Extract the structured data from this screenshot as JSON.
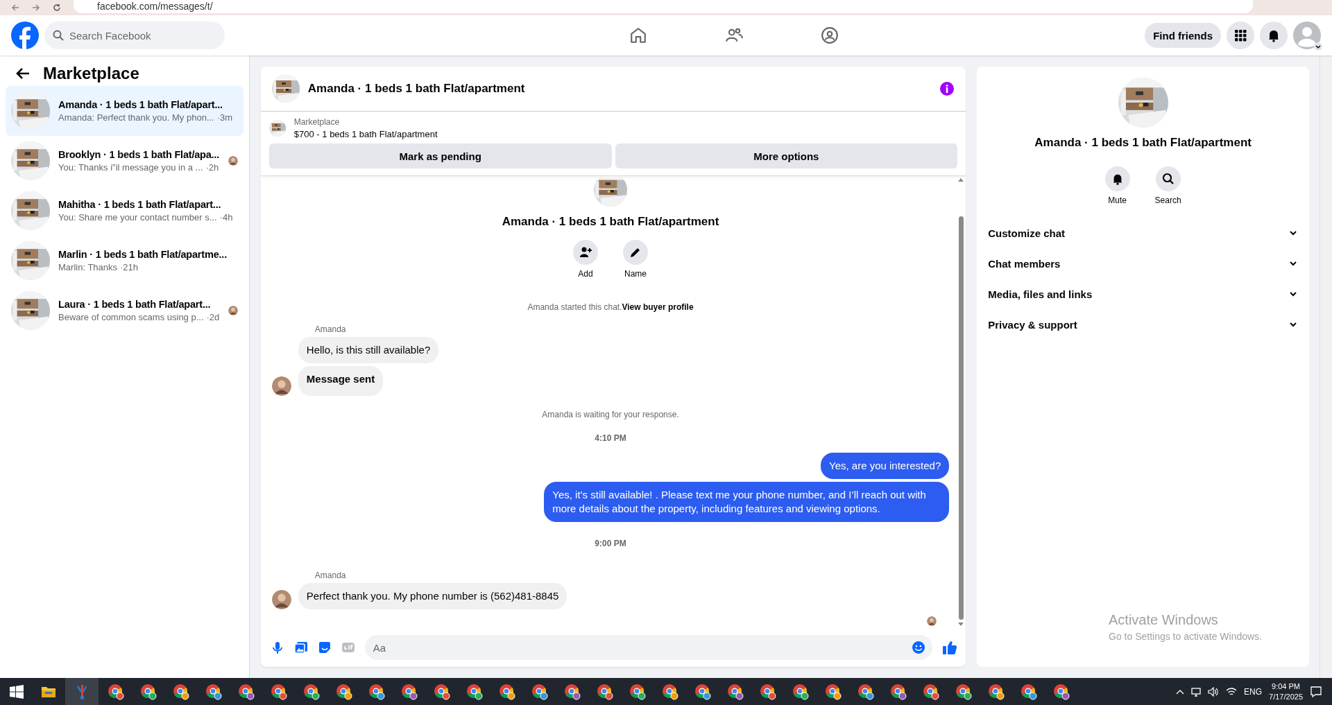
{
  "browser": {
    "address": "facebook.com/messages/t/"
  },
  "header": {
    "search_placeholder": "Search Facebook",
    "find_friends": "Find friends"
  },
  "sidebar": {
    "title": "Marketplace",
    "conversations": [
      {
        "title": "Amanda · 1 beds 1 bath Flat/apart...",
        "preview": "Amanda: Perfect thank you. My phon...",
        "time": "·3m",
        "selected": true,
        "seen": false
      },
      {
        "title": "Brooklyn · 1 beds 1 bath Flat/apa...",
        "preview": "You: Thanks i\"il message you in a ...",
        "time": "·2h",
        "selected": false,
        "seen": true
      },
      {
        "title": "Mahitha · 1 beds 1 bath Flat/apart...",
        "preview": "You: Share me your contact number s...",
        "time": "·4h",
        "selected": false,
        "seen": false
      },
      {
        "title": "Marlin · 1 beds 1 bath Flat/apartme...",
        "preview": "Marlin: Thanks",
        "time": "·21h",
        "selected": false,
        "seen": false
      },
      {
        "title": "Laura · 1 beds 1 bath Flat/apart...",
        "preview": "Beware of common scams using p...",
        "time": "·2d",
        "selected": false,
        "seen": true
      }
    ]
  },
  "chat": {
    "title": "Amanda · 1 beds 1 bath Flat/apartment",
    "listing": {
      "label": "Marketplace",
      "description": "$700 - 1 beds 1 bath Flat/apartment"
    },
    "actions": [
      "Mark as pending",
      "More options"
    ],
    "intro": {
      "title": "Amanda · 1 beds 1 bath Flat/apartment",
      "buttons": [
        {
          "label": "Add",
          "kind": "add"
        },
        {
          "label": "Name",
          "kind": "edit"
        }
      ]
    },
    "messages": [
      {
        "kind": "system",
        "text": "Amanda started this chat.",
        "link": "View buyer profile"
      },
      {
        "kind": "sender",
        "text": "Amanda"
      },
      {
        "kind": "incoming",
        "text": "Hello, is this still available?",
        "bold": false,
        "avatar": false
      },
      {
        "kind": "incoming",
        "text": "Message sent",
        "bold": true,
        "avatar": true
      },
      {
        "kind": "system",
        "text": "Amanda is waiting for your response."
      },
      {
        "kind": "time",
        "text": "4:10 PM"
      },
      {
        "kind": "outgoing",
        "text": "Yes, are you interested?"
      },
      {
        "kind": "outgoing",
        "text": "Yes, it’s still available! . Please text me your phone number, and I’ll reach out with more details about the property, including features and viewing options."
      },
      {
        "kind": "time",
        "text": "9:00 PM"
      },
      {
        "kind": "sender",
        "text": "Amanda"
      },
      {
        "kind": "incoming",
        "text": "Perfect thank you. My phone number is (562)481-8845",
        "bold": false,
        "avatar": true
      },
      {
        "kind": "seen"
      }
    ],
    "composer_placeholder": "Aa"
  },
  "details": {
    "title": "Amanda · 1 beds 1 bath Flat/apartment",
    "buttons": [
      {
        "label": "Mute",
        "kind": "bell"
      },
      {
        "label": "Search",
        "kind": "search"
      }
    ],
    "sections": [
      {
        "label": "Customize chat",
        "expanded": false
      },
      {
        "label": "Chat members",
        "expanded": false
      },
      {
        "label": "Media, files and links",
        "expanded": false
      },
      {
        "label": "Privacy & support",
        "expanded": false
      }
    ]
  },
  "activation_notice": {
    "title": "Activate Windows",
    "subtitle": "Go to Settings to activate Windows."
  },
  "taskbar": {
    "language": "ENG",
    "time": "9:04 PM",
    "date": "7/17/2025"
  }
}
